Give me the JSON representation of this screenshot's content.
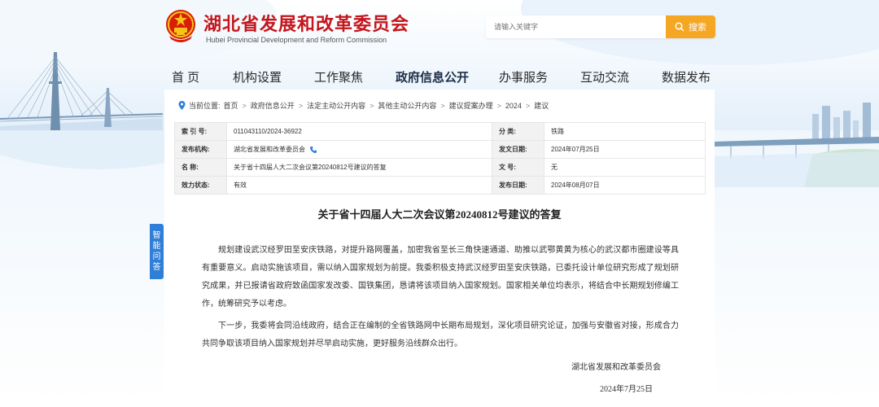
{
  "header": {
    "site_title": "湖北省发展和改革委员会",
    "site_subtitle": "Hubei Provincial Development and Reform Commission",
    "search_placeholder": "请输入关键字",
    "search_button": "搜索"
  },
  "nav": [
    {
      "label": "首 页"
    },
    {
      "label": "机构设置"
    },
    {
      "label": "工作聚焦"
    },
    {
      "label": "政府信息公开"
    },
    {
      "label": "办事服务"
    },
    {
      "label": "互动交流"
    },
    {
      "label": "数据发布"
    }
  ],
  "side_tab": {
    "chars": [
      "智",
      "能",
      "问",
      "答"
    ]
  },
  "breadcrumb": {
    "prefix": "当前位置:",
    "items": [
      "首页",
      "政府信息公开",
      "法定主动公开内容",
      "其他主动公开内容",
      "建议提案办理",
      "2024",
      "建议"
    ]
  },
  "meta": {
    "index_label": "索 引 号:",
    "index_value": "011043110/2024-36922",
    "category_label": "分 类:",
    "category_value": "铁路",
    "publisher_label": "发布机构:",
    "publisher_value": "湖北省发展和改革委员会",
    "date_label": "发文日期:",
    "date_value": "2024年07月25日",
    "name_label": "名 称:",
    "name_value": "关于省十四届人大二次会议第20240812号建议的答复",
    "docno_label": "文 号:",
    "docno_value": "无",
    "status_label": "效力状态:",
    "status_value": "有效",
    "pubdate_label": "发布日期:",
    "pubdate_value": "2024年08月07日"
  },
  "article": {
    "title": "关于省十四届人大二次会议第20240812号建议的答复",
    "p1": "规划建设武汉经罗田至安庆铁路，对提升路网覆盖，加密我省至长三角快速通道、助推以武鄂黄黄为核心的武汉都市圈建设等具有重要意义。启动实施该项目，需以纳入国家规划为前提。我委积极支持武汉经罗田至安庆铁路，已委托设计单位研究形成了规划研究成果，并已报请省政府致函国家发改委、国铁集团，恳请将该项目纳入国家规划。国家相关单位均表示，将结合中长期规划修编工作，统筹研究予以考虑。",
    "p2": "下一步，我委将会同沿线政府，结合正在编制的全省铁路网中长期布局规划，深化项目研究论证，加强与安徽省对接，形成合力共同争取该项目纳入国家规划并尽早启动实施，更好服务沿线群众出行。",
    "sign_org": "湖北省发展和改革委员会",
    "sign_date": "2024年7月25日"
  },
  "colors": {
    "brand_red": "#c4161c",
    "accent_orange": "#f5a623",
    "side_blue": "#2f7ed8"
  }
}
